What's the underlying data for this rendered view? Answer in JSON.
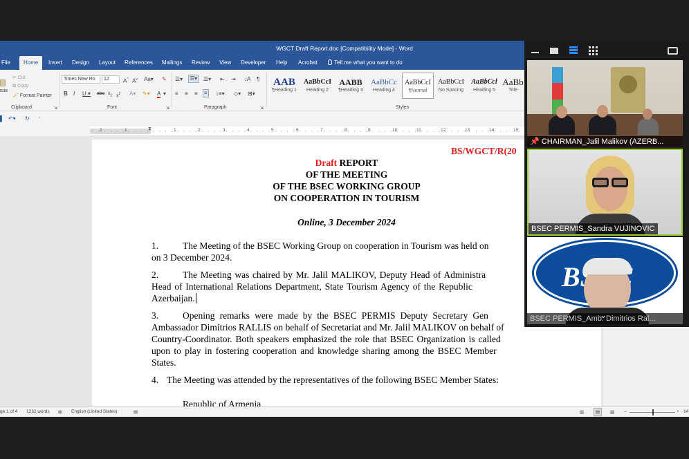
{
  "window": {
    "title": "WGCT Draft Report.doc [Compatibility Mode]  -  Word"
  },
  "tabs": [
    {
      "label": "File"
    },
    {
      "label": "Home"
    },
    {
      "label": "Insert"
    },
    {
      "label": "Design"
    },
    {
      "label": "Layout"
    },
    {
      "label": "References"
    },
    {
      "label": "Mailings"
    },
    {
      "label": "Review"
    },
    {
      "label": "View"
    },
    {
      "label": "Developer"
    },
    {
      "label": "Help"
    },
    {
      "label": "Acrobat"
    }
  ],
  "tell_me": "Tell me what you want to do",
  "ribbon": {
    "clipboard": {
      "cut": "Cut",
      "copy": "Copy",
      "paste": "aste",
      "format_painter": "Format Painter",
      "label": "Clipboard"
    },
    "font": {
      "name": "Times New Ro",
      "size": "12",
      "label": "Font"
    },
    "paragraph": {
      "label": "Paragraph"
    },
    "styles": {
      "label": "Styles",
      "items": [
        {
          "sample": "AAB",
          "name": "¶Heading 1"
        },
        {
          "sample": "AaBbCcI",
          "name": "Heading 2"
        },
        {
          "sample": "AABB",
          "name": "¶Heading 3"
        },
        {
          "sample": "AaBbCc",
          "name": "Heading 4"
        },
        {
          "sample": "AaBbCcI",
          "name": "¶Normal"
        },
        {
          "sample": "AaBbCcI",
          "name": "No Spacing"
        },
        {
          "sample": "AaBbCcl",
          "name": "Heading 5"
        },
        {
          "sample": "AaBb",
          "name": "Title"
        }
      ]
    }
  },
  "ruler": [
    "2",
    "1",
    "1",
    "2",
    "3",
    "4",
    "5",
    "6",
    "7",
    "8",
    "9",
    "10",
    "11",
    "12",
    "13",
    "14",
    "15"
  ],
  "document": {
    "ref": "BS/WGCT/R(20",
    "title_draft": "Draft",
    "title_1": " REPORT",
    "title_2": "OF THE MEETING",
    "title_3": "OF THE BSEC WORKING GROUP",
    "title_4": "ON COOPERATION IN TOURISM",
    "location": "Online, 3 December 2024",
    "p1_num": "1.",
    "p1": "The Meeting of the BSEC Working Group on cooperation in Tourism was held on",
    "p1b": "on 3 December 2024.",
    "p2_num": "2.",
    "p2": "The Meeting was chaired by Mr. Jalil MALIKOV, Deputy Head of Administra",
    "p2b": "Head of International Relations Department, State Tourism Agency of the Republic",
    "p2c": "Azerbaijan.",
    "p3_num": "3.",
    "p3": "Opening remarks were made by the BSEC PERMIS Deputy Secretary Gen",
    "p3b": "Ambassador Dimitrios RALLIS on behalf of Secretariat and Mr. Jalil MALIKOV on behalf of",
    "p3c": "Country-Coordinator. Both speakers emphasized the role that BSEC Organization is called",
    "p3d": "upon to play in fostering cooperation and knowledge sharing among the BSEC Member",
    "p3e": "States.",
    "p4_num": "4.",
    "p4": "The Meeting was attended by the representatives of the following BSEC Member States:",
    "p5": "Republic of Armenia"
  },
  "status": {
    "page": "ge 1 of 4",
    "words": "1232 words",
    "language": "English (United States)",
    "zoom": "14"
  },
  "video": {
    "participants": [
      {
        "name": "CHAIRMAN_Jalil Malikov (AZERB..."
      },
      {
        "name": "BSEC PERMIS_Sandra VUJINOVIC"
      },
      {
        "name": "BSEC PERMIS_Amb. Dimitrios Ral..."
      }
    ],
    "logo_text": "BSEC"
  },
  "colors": {
    "word_blue": "#2b579a",
    "draft_red": "#e31b1b",
    "active_speaker": "#9acd32"
  }
}
